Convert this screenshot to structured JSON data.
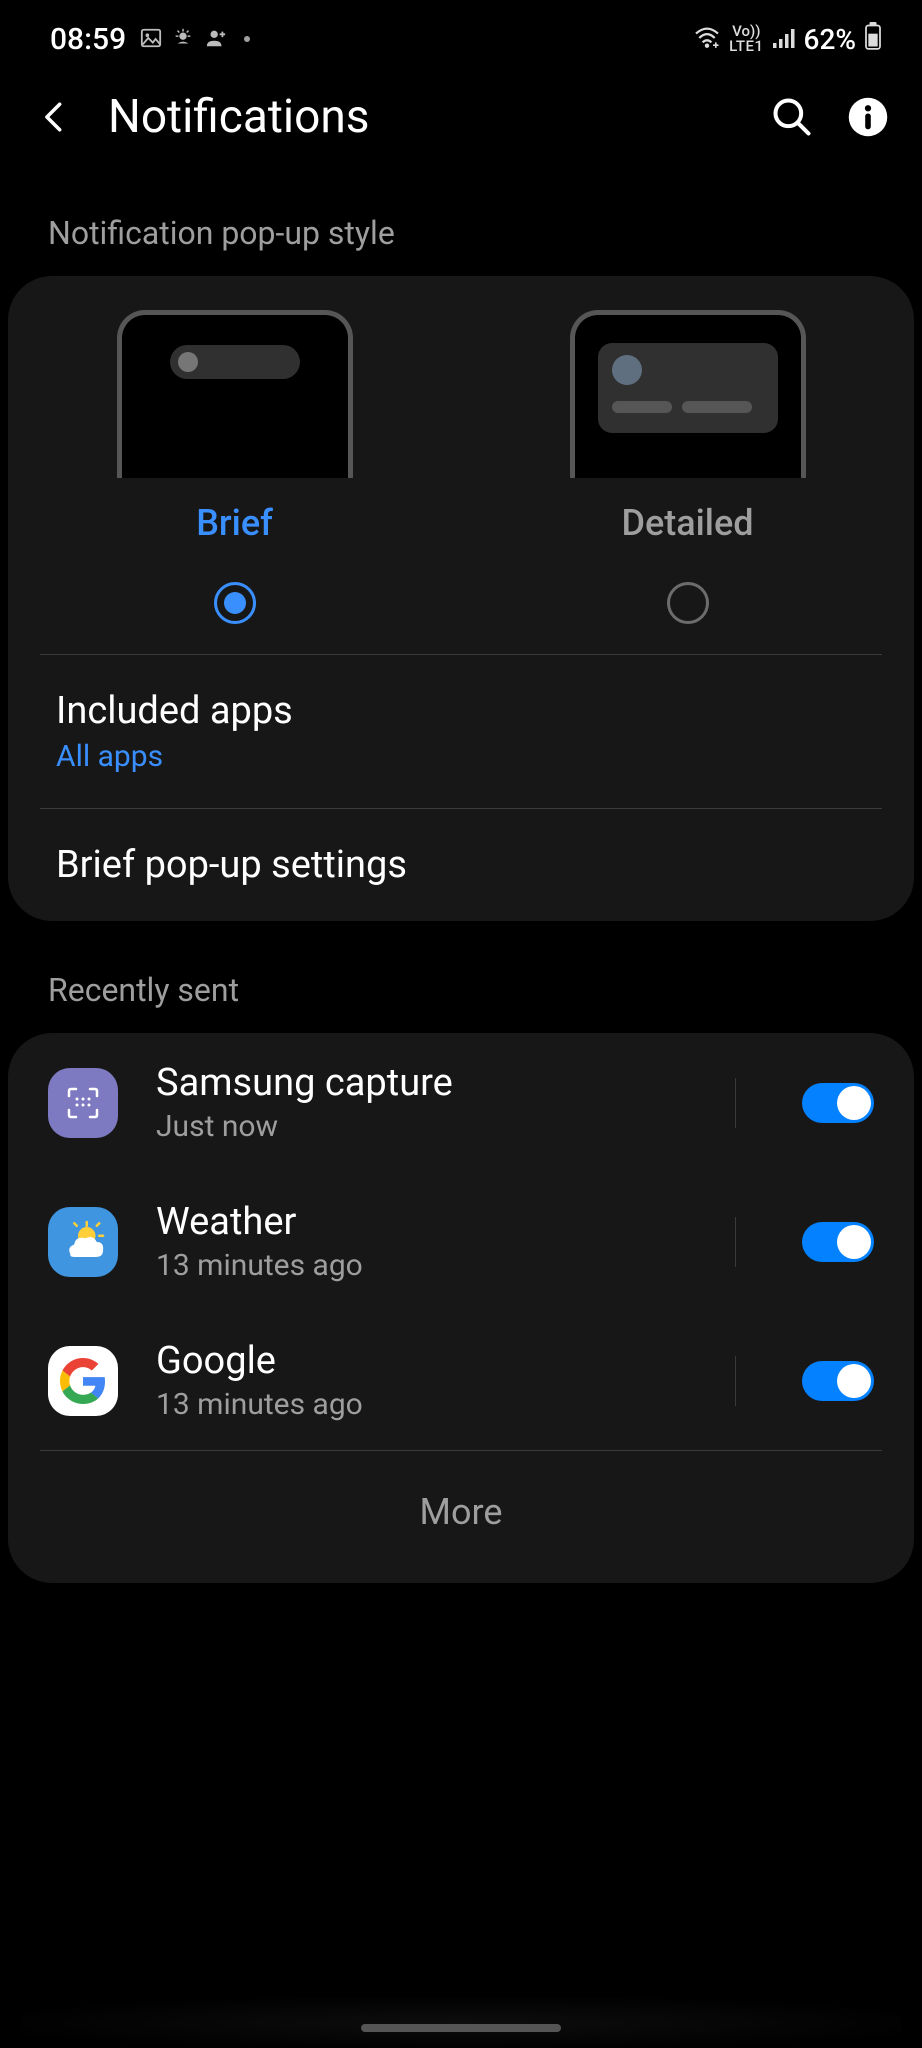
{
  "status": {
    "time": "08:59",
    "battery": "62%"
  },
  "header": {
    "title": "Notifications"
  },
  "popup_style": {
    "heading": "Notification pop-up style",
    "brief_label": "Brief",
    "detailed_label": "Detailed",
    "included_title": "Included apps",
    "included_sub": "All apps",
    "brief_settings": "Brief pop-up settings"
  },
  "recent": {
    "heading": "Recently sent",
    "apps": [
      {
        "name": "Samsung capture",
        "time": "Just now",
        "enabled": true
      },
      {
        "name": "Weather",
        "time": "13 minutes ago",
        "enabled": true
      },
      {
        "name": "Google",
        "time": "13 minutes ago",
        "enabled": true
      }
    ],
    "more": "More"
  }
}
